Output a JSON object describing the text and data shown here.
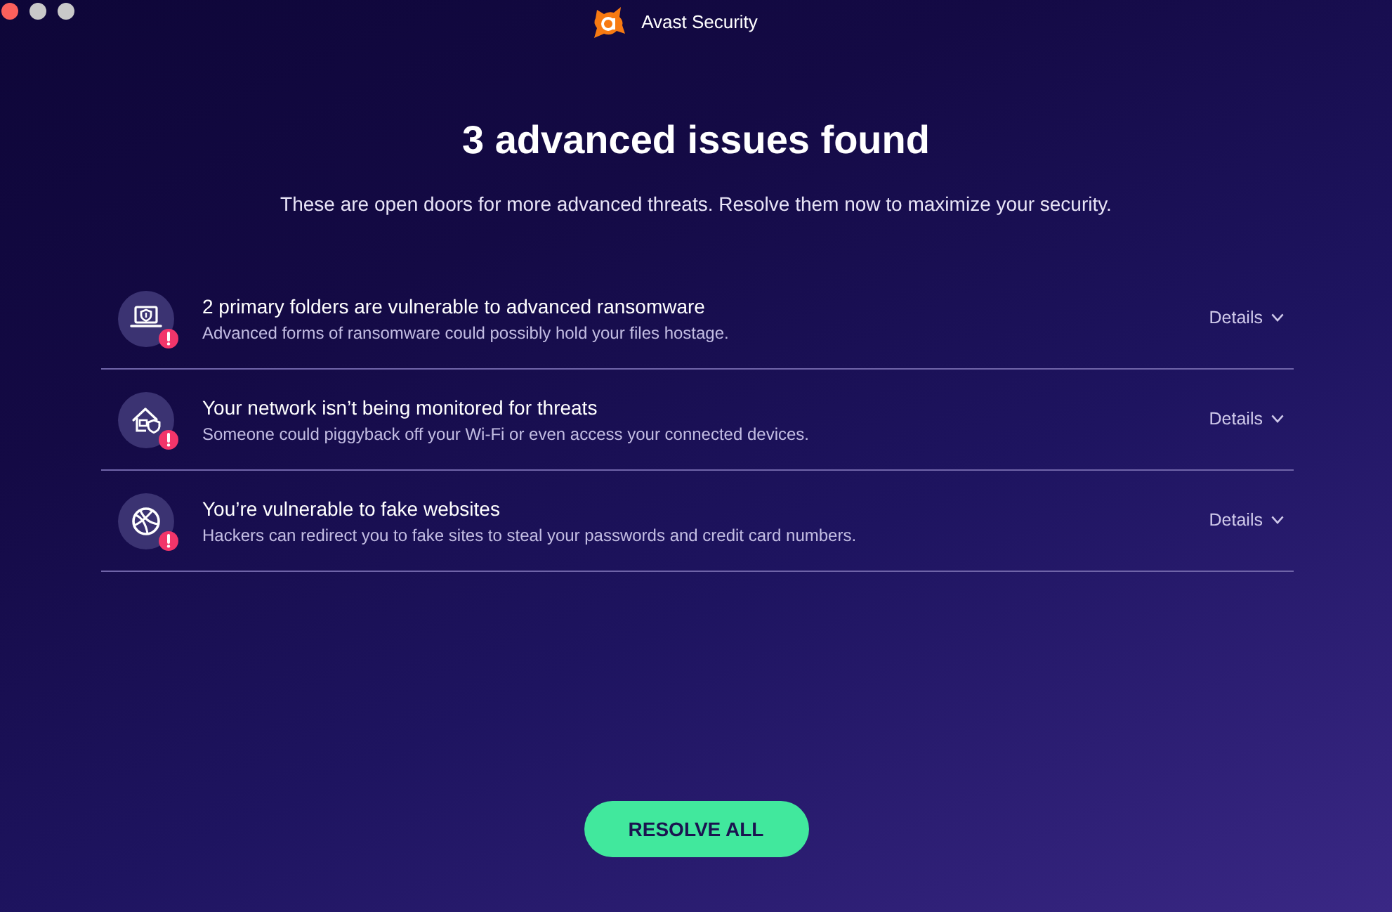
{
  "window": {
    "title": "Avast Security",
    "controls": [
      {
        "kind": "close",
        "disabled": false
      },
      {
        "kind": "minimize",
        "disabled": true
      },
      {
        "kind": "zoom",
        "disabled": true
      }
    ]
  },
  "heading": "3 advanced issues found",
  "subtitle": "These are open doors for more advanced threats. Resolve them now to maximize your security.",
  "issues": [
    {
      "kind": "ransomware",
      "alert": true,
      "title": "2 primary folders are vulnerable to advanced ransomware",
      "description": "Advanced forms of ransomware could possibly hold your files hostage.",
      "details": "Details"
    },
    {
      "kind": "network",
      "alert": true,
      "title": "Your network isn’t being monitored for threats",
      "description": "Someone could piggyback off your Wi-Fi or even access your connected devices.",
      "details": "Details"
    },
    {
      "kind": "web",
      "alert": true,
      "title": "You’re vulnerable to fake websites",
      "description": "Hackers can redirect you to fake sites to steal your passwords and credit card numbers.",
      "details": "Details"
    }
  ],
  "resolve_button": "RESOLVE ALL"
}
